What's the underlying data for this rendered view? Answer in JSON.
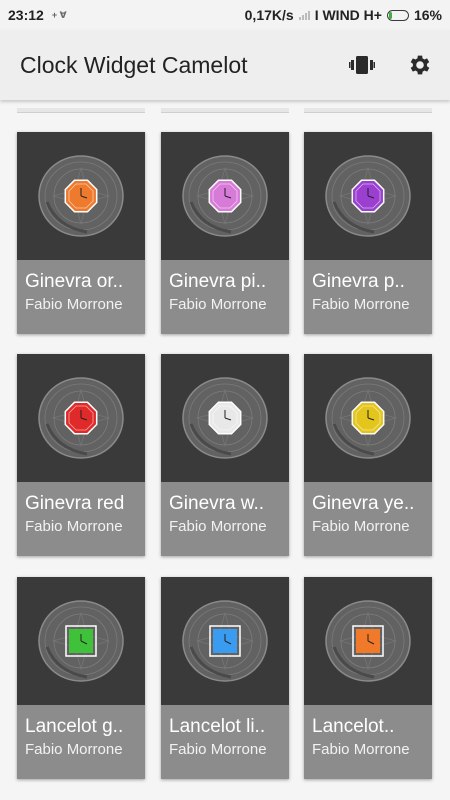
{
  "status_bar": {
    "time": "23:12",
    "mini_icons": "+ ∀",
    "speed": "0,17K/s",
    "carrier": "I WIND H+",
    "battery_percent": "16%",
    "battery_level": 0.16
  },
  "app_bar": {
    "title": "Clock Widget Camelot",
    "actions": [
      {
        "name": "watch-icon"
      },
      {
        "name": "gear-icon"
      }
    ]
  },
  "colors": {
    "card_bg": "#3a3a3a",
    "info_bg": "#8c8c8c",
    "app_bar_bg": "#eeeeee",
    "battery_green": "#3fae45"
  },
  "widgets": [
    {
      "name": "Ginevra or..",
      "author": "Fabio Morrone",
      "shape": "octagon",
      "color": "#ee7a2e"
    },
    {
      "name": "Ginevra pi..",
      "author": "Fabio Morrone",
      "shape": "octagon",
      "color": "#d77ad8"
    },
    {
      "name": "Ginevra p..",
      "author": "Fabio Morrone",
      "shape": "octagon",
      "color": "#9a3fd0"
    },
    {
      "name": "Ginevra red",
      "author": "Fabio Morrone",
      "shape": "octagon",
      "color": "#e02a2a"
    },
    {
      "name": "Ginevra w..",
      "author": "Fabio Morrone",
      "shape": "octagon",
      "color": "#e8e8e8"
    },
    {
      "name": "Ginevra ye..",
      "author": "Fabio Morrone",
      "shape": "octagon",
      "color": "#e3c51b"
    },
    {
      "name": "Lancelot g..",
      "author": "Fabio Morrone",
      "shape": "square",
      "color": "#3fc23a"
    },
    {
      "name": "Lancelot li..",
      "author": "Fabio Morrone",
      "shape": "square",
      "color": "#3a9cf0"
    },
    {
      "name": "Lancelot..",
      "author": "Fabio Morrone",
      "shape": "square",
      "color": "#f07a2a"
    }
  ]
}
